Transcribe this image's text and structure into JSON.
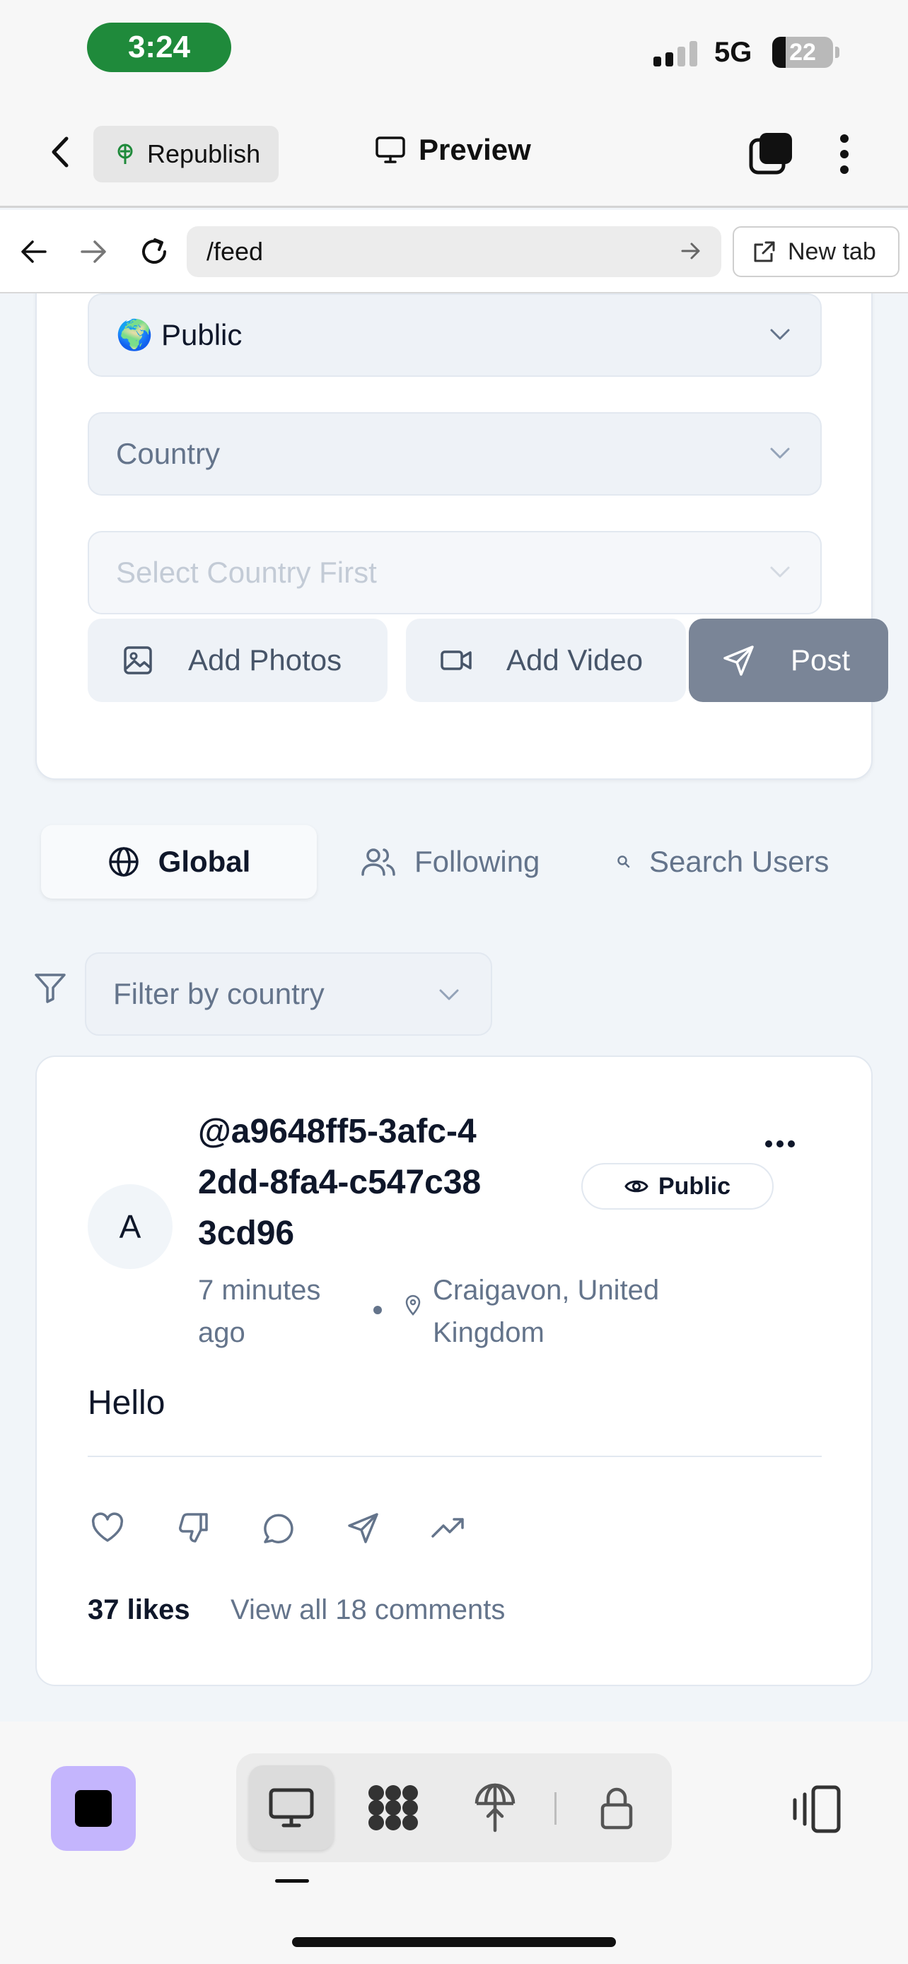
{
  "status_bar": {
    "time": "3:24",
    "network": "5G",
    "battery": "22",
    "battery_level": 0.22
  },
  "app_toolbar": {
    "republish_label": "Republish",
    "preview_label": "Preview"
  },
  "url_bar": {
    "url": "/feed",
    "new_tab_label": "New tab"
  },
  "compose": {
    "visibility_select": "🌍 Public",
    "country_select": "Country",
    "city_select": "Select Country First",
    "add_photos_label": "Add Photos",
    "add_video_label": "Add Video",
    "post_label": "Post"
  },
  "feed_tabs": [
    {
      "label": "Global",
      "icon": "globe-icon",
      "active": true
    },
    {
      "label": "Following",
      "icon": "users-icon",
      "active": false
    },
    {
      "label": "Search Users",
      "icon": "search-icon",
      "active": false
    }
  ],
  "filter": {
    "placeholder": "Filter by country"
  },
  "post": {
    "avatar_initial": "A",
    "username": "@a9648ff5-3afc-42dd-8fa4-c547c383cd96",
    "visibility": "Public",
    "time_ago": "7 minutes ago",
    "location": "Craigavon, United Kingdom",
    "text": "Hello",
    "likes": "37 likes",
    "comments_link": "View all 18 comments"
  },
  "colors": {
    "accent_green": "#1f8a3b",
    "post_button": "#7a8597",
    "stop_button": "#c4b5fd"
  }
}
